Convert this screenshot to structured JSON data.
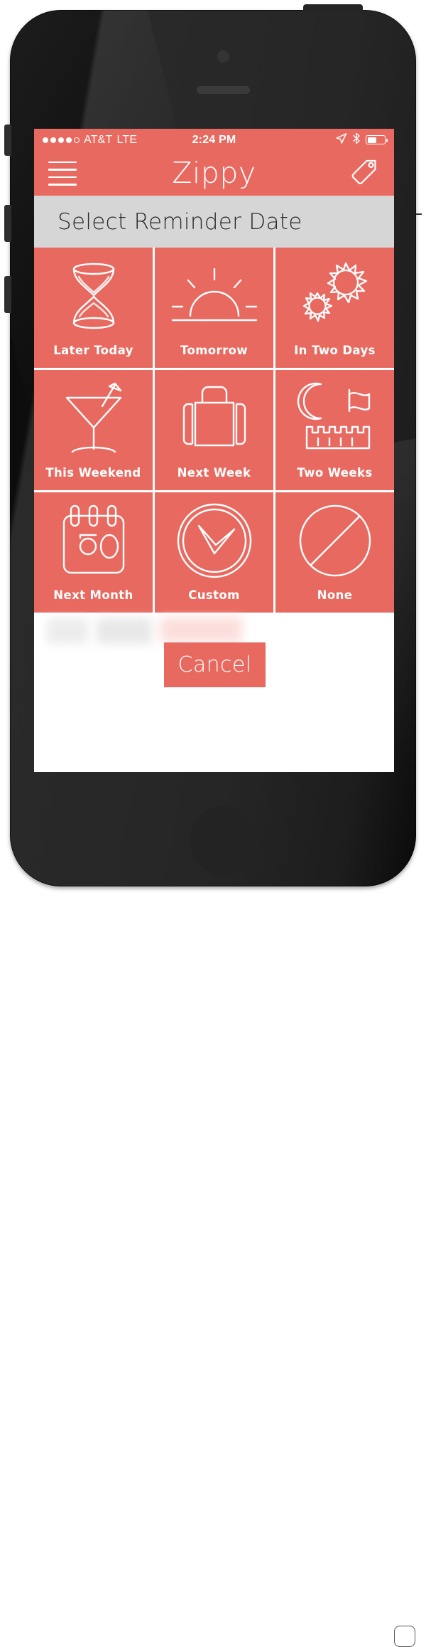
{
  "device": {
    "name": "iphone-5-black",
    "frame_color": "#1d1d1d",
    "hardware": {
      "power_button": "power-button",
      "silent_switch": "silent-switch",
      "volume_up": "volume-up-button",
      "volume_down": "volume-down-button",
      "camera": "camera-lens",
      "speaker": "earpiece-speaker",
      "home_button": "home-button"
    }
  },
  "theme": {
    "accent": "#E8695F",
    "title_bar_bg": "#D6D6D6",
    "screen_bg": "#FFFFFF",
    "text_on_accent": "#FFFFFF"
  },
  "status_bar": {
    "signal_dots_filled": 4,
    "signal_dots_total": 5,
    "carrier": "AT&T",
    "network": "LTE",
    "time": "2:24 PM",
    "icons": [
      "location-arrow-icon",
      "bluetooth-icon",
      "battery-icon"
    ],
    "battery_percent": 55
  },
  "nav_bar": {
    "menu_icon": "hamburger-menu-icon",
    "title": "Zippy",
    "action_icon": "tag-icon"
  },
  "sheet": {
    "title": "Select Reminder Date",
    "options": [
      {
        "label": "Later Today",
        "icon": "hourglass-icon"
      },
      {
        "label": "Tomorrow",
        "icon": "sunrise-icon"
      },
      {
        "label": "In Two Days",
        "icon": "two-suns-icon"
      },
      {
        "label": "This Weekend",
        "icon": "cocktail-icon"
      },
      {
        "label": "Next Week",
        "icon": "suitcase-icon"
      },
      {
        "label": "Two Weeks",
        "icon": "moon-castle-icon"
      },
      {
        "label": "Next Month",
        "icon": "calendar-30-icon"
      },
      {
        "label": "Custom",
        "icon": "clock-icon"
      },
      {
        "label": "None",
        "icon": "no-entry-icon"
      }
    ],
    "calendar_day_number": "30",
    "cancel_label": "Cancel"
  }
}
